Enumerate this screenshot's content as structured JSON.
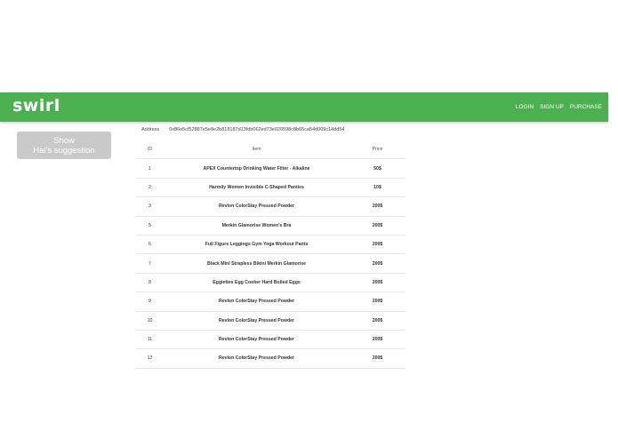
{
  "navbar": {
    "brand": "swirl",
    "links": [
      "LOGIN",
      "SIGN UP",
      "PURCHASE"
    ],
    "color": "#4caf50"
  },
  "suggestion_button": {
    "line1": "Show",
    "line2": "Hai's suggestion"
  },
  "address": {
    "label": "Address",
    "value": "0x86e5cf52887e5e8e2b818187d13fdb062ed73e020598c8b65ca54d009c14dd54"
  },
  "table": {
    "headers": [
      "ID",
      "Item",
      "Price"
    ],
    "rows": [
      {
        "id": "1",
        "item": "APEX Countertop Drinking Water Filter - Alkaline",
        "price": "50$"
      },
      {
        "id": "2",
        "item": "Harmily Women Invisible C-Shaped Panties",
        "price": "10$"
      },
      {
        "id": "3",
        "item": "Revlon ColorStay Pressed Powder",
        "price": "200$"
      },
      {
        "id": "5",
        "item": "Merkin Glamorise Women's Bra",
        "price": "200$"
      },
      {
        "id": "6",
        "item": "Full Figure Leggings Gym Yoga Workout Pants",
        "price": "200$"
      },
      {
        "id": "7",
        "item": "Black Mini Strapless Bikini Merkin Glamorise",
        "price": "200$"
      },
      {
        "id": "8",
        "item": "Eggiettes Egg Cooker Hard Boiled Eggs",
        "price": "200$"
      },
      {
        "id": "9",
        "item": "Revlon ColorStay Pressed Powder",
        "price": "200$"
      },
      {
        "id": "10",
        "item": "Revlon ColorStay Pressed Powder",
        "price": "200$"
      },
      {
        "id": "11",
        "item": "Revlon ColorStay Pressed Powder",
        "price": "200$"
      },
      {
        "id": "12",
        "item": "Revlon ColorStay Pressed Powder",
        "price": "200$"
      }
    ]
  }
}
